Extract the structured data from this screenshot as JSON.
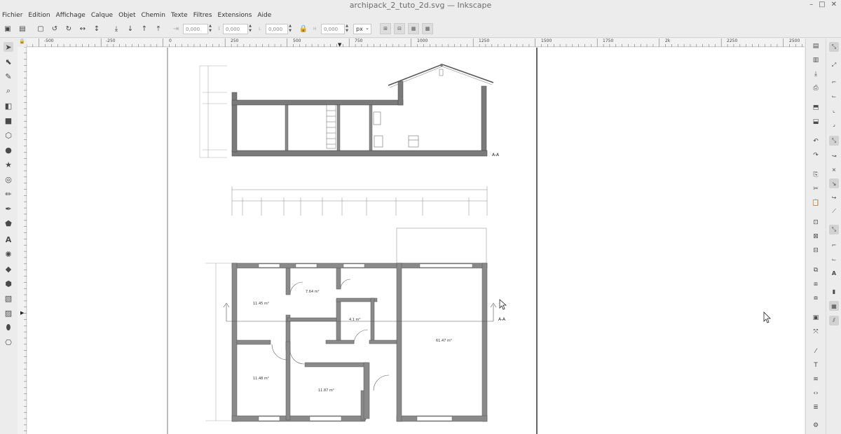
{
  "window": {
    "title": "archipack_2_tuto_2d.svg — Inkscape"
  },
  "menu": [
    "Fichier",
    "Edition",
    "Affichage",
    "Calque",
    "Objet",
    "Chemin",
    "Texte",
    "Filtres",
    "Extensions",
    "Aide"
  ],
  "toolbar": {
    "x_value": "0,000",
    "y_value": "0,000",
    "w_label": "L",
    "w_value": "0,000",
    "h_label": "H",
    "h_value": "0,000",
    "unit": "px"
  },
  "hruler_labels": [
    "-500",
    "-250",
    "0",
    "250",
    "500",
    "750",
    "1000",
    "1250",
    "1500",
    "1750",
    "2k",
    "2250",
    "2500"
  ],
  "drawing": {
    "section_label": "A-A",
    "cut_label": "A-A",
    "rooms": [
      {
        "label": "11.45 m²"
      },
      {
        "label": "7.64 m²"
      },
      {
        "label": "4.1 m²"
      },
      {
        "label": "61.47 m²"
      },
      {
        "label": "11.48 m²"
      },
      {
        "label": "11.87 m²"
      }
    ]
  }
}
